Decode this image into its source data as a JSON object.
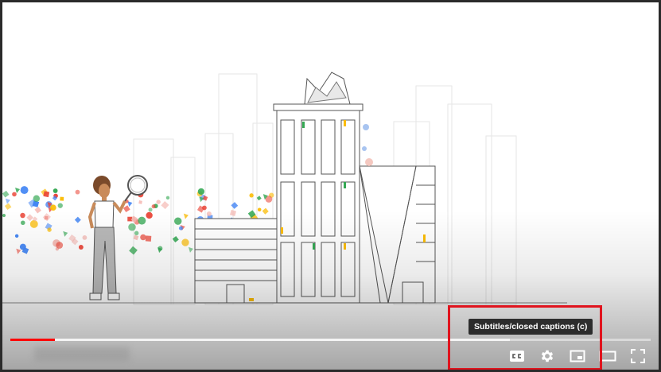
{
  "player": {
    "progress_fraction": 0.07,
    "buffered_fraction": 0.78,
    "tooltip": "Subtitles/closed captions (c)",
    "highlight_color": "#e0141e",
    "progress_color": "#ff0000"
  },
  "controls": [
    {
      "name": "subtitles-button",
      "icon": "cc-icon"
    },
    {
      "name": "settings-button",
      "icon": "gear-icon"
    },
    {
      "name": "miniplayer-button",
      "icon": "miniplayer-icon"
    },
    {
      "name": "theater-mode-button",
      "icon": "theater-icon"
    },
    {
      "name": "fullscreen-button",
      "icon": "fullscreen-icon"
    }
  ],
  "illustration": {
    "palette": [
      "#ea4335",
      "#4285f4",
      "#fbbc05",
      "#34a853",
      "#f4b6b0"
    ]
  }
}
